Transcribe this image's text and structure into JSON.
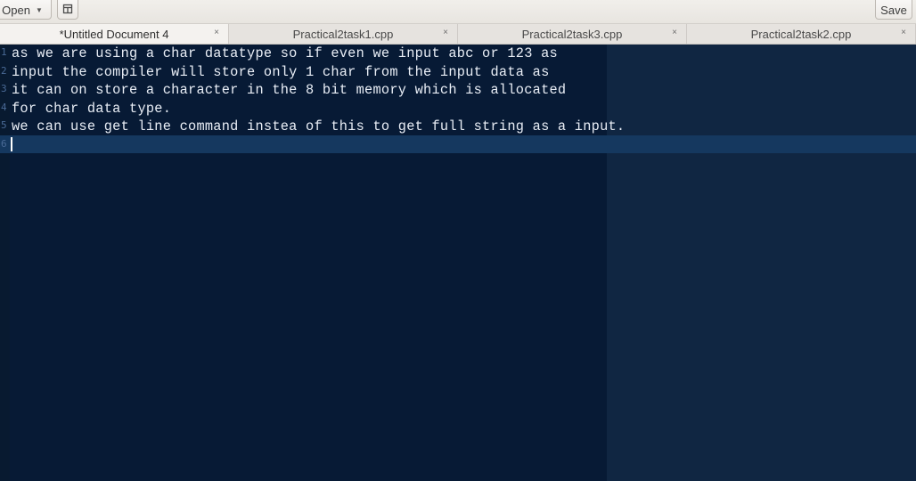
{
  "header": {
    "open_label": "Open",
    "save_label": "Save"
  },
  "tabs": [
    {
      "label": "*Untitled Document 4",
      "active": true
    },
    {
      "label": "Practical2task1.cpp",
      "active": false
    },
    {
      "label": "Practical2task3.cpp",
      "active": false
    },
    {
      "label": "Practical2task2.cpp",
      "active": false
    }
  ],
  "tab_close_glyph": "×",
  "editor": {
    "lines": [
      {
        "num": "1",
        "text": "as we are using a char datatype so if even we input abc or 123 as"
      },
      {
        "num": "2",
        "text": "input the compiler will store only 1 char from the input data as"
      },
      {
        "num": "3",
        "text": "it can on store a character in the 8 bit memory which is allocated"
      },
      {
        "num": "4",
        "text": "for char data type."
      },
      {
        "num": "5",
        "text": "we can use get line command instea of this to get full string as a input."
      },
      {
        "num": "6",
        "text": ""
      }
    ],
    "current_line": 6
  },
  "icons": {
    "open_dropdown": "chevron-down-icon",
    "pin": "pin-icon"
  },
  "colors": {
    "editor_bg": "#071a35",
    "current_line": "#15385f",
    "text": "#e9eef6",
    "line_numbers": "#4a6a96"
  }
}
